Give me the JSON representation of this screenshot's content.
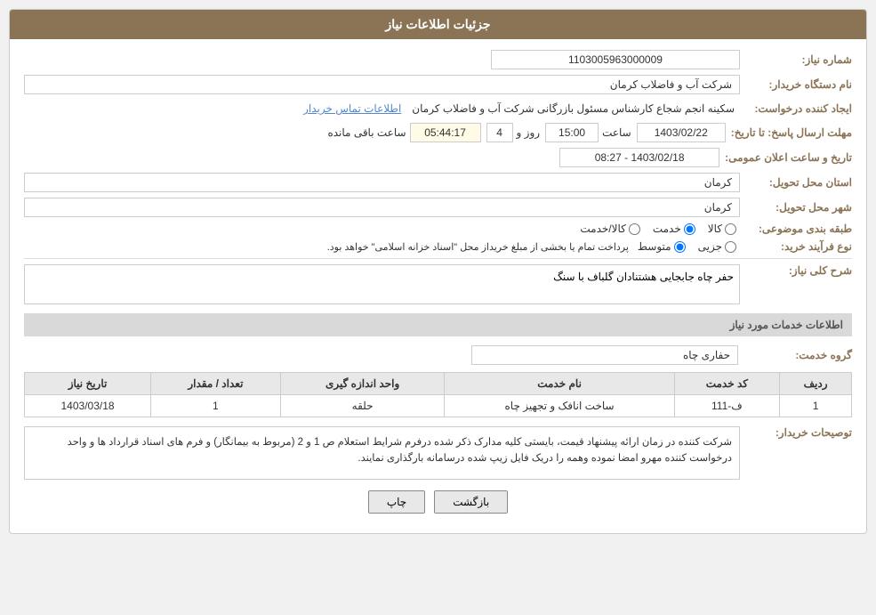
{
  "header": {
    "title": "جزئیات اطلاعات نیاز"
  },
  "fields": {
    "need_number_label": "شماره نیاز:",
    "need_number_value": "1103005963000009",
    "buyer_label": "نام دستگاه خریدار:",
    "buyer_value": "شرکت آب و فاضلاب کرمان",
    "creator_label": "ایجاد کننده درخواست:",
    "creator_value": "سکینه انجم شجاع کارشناس مسئول بازرگانی شرکت آب و فاضلاب کرمان",
    "creator_link": "اطلاعات تماس خریدار",
    "deadline_label": "مهلت ارسال پاسخ: تا تاریخ:",
    "deadline_date": "1403/02/22",
    "deadline_time_label": "ساعت",
    "deadline_time": "15:00",
    "deadline_days_label": "روز و",
    "deadline_days": "4",
    "deadline_remaining_label": "ساعت باقی مانده",
    "deadline_remaining": "05:44:17",
    "announce_label": "تاریخ و ساعت اعلان عمومی:",
    "announce_value": "1403/02/18 - 08:27",
    "province_label": "استان محل تحویل:",
    "province_value": "کرمان",
    "city_label": "شهر محل تحویل:",
    "city_value": "کرمان",
    "category_label": "طبقه بندی موضوعی:",
    "category_options": [
      "کالا",
      "خدمت",
      "کالا/خدمت"
    ],
    "category_selected": "خدمت",
    "process_label": "نوع فرآیند خرید:",
    "process_options": [
      "جزیی",
      "متوسط"
    ],
    "process_selected": "متوسط",
    "process_note": "پرداخت تمام یا بخشی از مبلغ خریداز محل \"اسناد خزانه اسلامی\" خواهد بود.",
    "need_desc_label": "شرح کلی نیاز:",
    "need_desc_value": "حفر چاه جابجایی هشتنادان گلباف با سنگ"
  },
  "service_section": {
    "title": "اطلاعات خدمات مورد نیاز",
    "service_group_label": "گروه خدمت:",
    "service_group_value": "حفاری چاه",
    "table_headers": [
      "ردیف",
      "کد خدمت",
      "نام خدمت",
      "واحد اندازه گیری",
      "تعداد / مقدار",
      "تاریخ نیاز"
    ],
    "table_rows": [
      {
        "row": "1",
        "code": "ف-111",
        "name": "ساخت انافک و تجهیز چاه",
        "unit": "حلقه",
        "count": "1",
        "date": "1403/03/18"
      }
    ]
  },
  "buyer_notes_label": "توصیحات خریدار:",
  "buyer_notes_value": "شرکت کننده در زمان ارائه پیشنهاد قیمت، بایستی کلیه مدارک ذکر شده درفرم شرایط استعلام ص 1  و  2 (مربوط به بیمانگار) و فرم های اسناد قرارداد ها و واحد درخواست کننده مهرو امضا نموده وهمه را دریک فایل زیپ شده درسامانه بارگذاری نمایند.",
  "buttons": {
    "back_label": "بازگشت",
    "print_label": "چاپ"
  }
}
